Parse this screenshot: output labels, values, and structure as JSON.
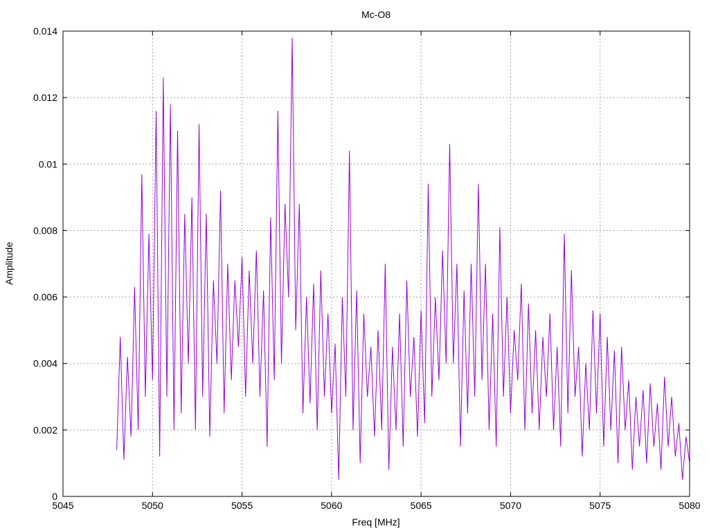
{
  "chart_data": {
    "type": "line",
    "title": "Mc-O8",
    "xlabel": "Freq [MHz]",
    "ylabel": "Amplitude",
    "xlim": [
      5045,
      5080
    ],
    "ylim": [
      0,
      0.014
    ],
    "xticks": [
      5045,
      5050,
      5055,
      5060,
      5065,
      5070,
      5075,
      5080
    ],
    "xtick_labels": [
      "5045",
      "5050",
      "5055",
      "5060",
      "5065",
      "5070",
      "5075",
      "5080"
    ],
    "yticks": [
      0,
      0.002,
      0.004,
      0.006,
      0.008,
      0.01,
      0.012,
      0.014
    ],
    "ytick_labels": [
      "0",
      "0.002",
      "0.004",
      "0.006",
      "0.008",
      "0.01",
      "0.012",
      "0.014"
    ],
    "grid": true,
    "legend": "none",
    "series": [
      {
        "name": "Mc-O8",
        "color": "#9400d3",
        "x_start": 5048.0,
        "x_step": 0.2,
        "values": [
          0.0014,
          0.0048,
          0.0011,
          0.0042,
          0.0018,
          0.0063,
          0.002,
          0.0097,
          0.003,
          0.0079,
          0.0035,
          0.0116,
          0.0012,
          0.0126,
          0.003,
          0.0118,
          0.002,
          0.011,
          0.0025,
          0.0085,
          0.004,
          0.009,
          0.002,
          0.0112,
          0.003,
          0.0085,
          0.0018,
          0.0065,
          0.004,
          0.0092,
          0.0025,
          0.007,
          0.0035,
          0.0065,
          0.0045,
          0.0072,
          0.003,
          0.0068,
          0.004,
          0.0074,
          0.003,
          0.0062,
          0.0015,
          0.0084,
          0.0035,
          0.0116,
          0.004,
          0.0088,
          0.006,
          0.0138,
          0.005,
          0.0088,
          0.0025,
          0.006,
          0.0028,
          0.0064,
          0.002,
          0.0068,
          0.003,
          0.0055,
          0.0025,
          0.0046,
          0.0005,
          0.006,
          0.003,
          0.0104,
          0.002,
          0.0062,
          0.001,
          0.0055,
          0.003,
          0.0045,
          0.0018,
          0.005,
          0.002,
          0.007,
          0.0008,
          0.0045,
          0.002,
          0.0055,
          0.0015,
          0.0065,
          0.003,
          0.0048,
          0.0018,
          0.0056,
          0.0022,
          0.0094,
          0.003,
          0.006,
          0.0035,
          0.0074,
          0.004,
          0.0106,
          0.004,
          0.007,
          0.0015,
          0.0062,
          0.0025,
          0.007,
          0.003,
          0.0094,
          0.0035,
          0.007,
          0.002,
          0.0055,
          0.0015,
          0.0081,
          0.003,
          0.006,
          0.0025,
          0.005,
          0.0035,
          0.0064,
          0.002,
          0.0058,
          0.0025,
          0.005,
          0.002,
          0.0048,
          0.003,
          0.0055,
          0.002,
          0.0045,
          0.0015,
          0.0079,
          0.0025,
          0.0068,
          0.003,
          0.0045,
          0.0012,
          0.004,
          0.002,
          0.0056,
          0.0025,
          0.0055,
          0.0015,
          0.0048,
          0.002,
          0.0044,
          0.001,
          0.0045,
          0.002,
          0.0035,
          0.0008,
          0.003,
          0.0015,
          0.0032,
          0.001,
          0.0034,
          0.0015,
          0.0028,
          0.0008,
          0.0036,
          0.0015,
          0.003,
          0.0012,
          0.0022,
          0.0005,
          0.0018,
          0.001,
          0.0016
        ]
      }
    ]
  }
}
